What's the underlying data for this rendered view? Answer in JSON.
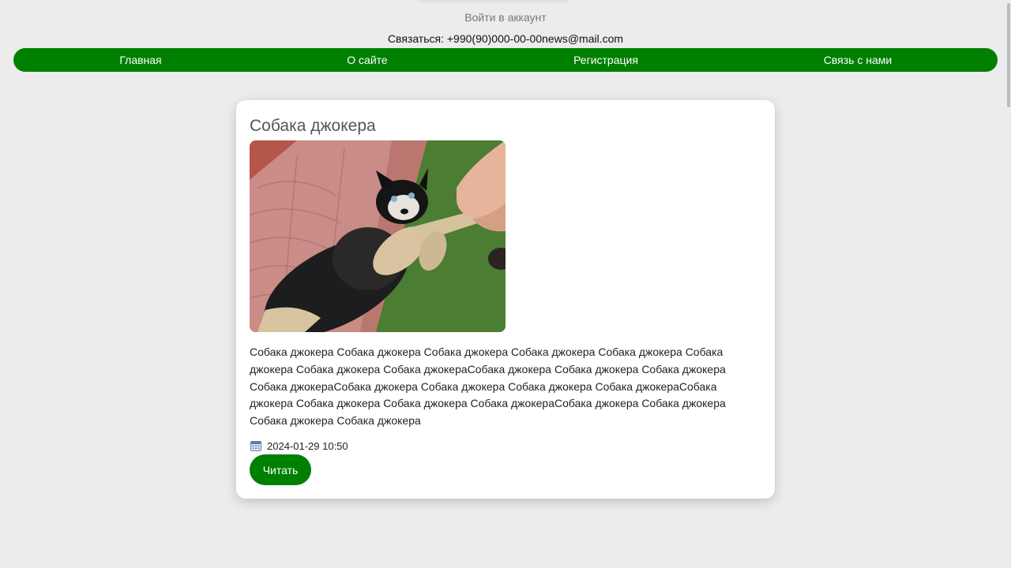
{
  "header": {
    "login_label": "Войти в аккаунт",
    "contact_text": "Связаться: +990(90)000-00-00news@mail.com"
  },
  "nav": {
    "items": [
      {
        "label": "Главная"
      },
      {
        "label": "О сайте"
      },
      {
        "label": "Регистрация"
      },
      {
        "label": "Связь с нами"
      }
    ],
    "color": "#008000"
  },
  "post": {
    "title": "Собака джокера",
    "image_icon": "dog-photo",
    "text": "Собака джокера Собака джокера Собака джокера Собака джокера Собака джокера Собака джокера Собака джокера Собака джокераСобака джокера Собака джокера Собака джокера Собака джокераСобака джокера Собака джокера Собака джокера Собака джокераСобака джокера Собака джокера Собака джокера Собака джокераСобака джокера Собака джокера Собака джокера Собака джокера",
    "date": "2024-01-29 10:50",
    "date_icon": "calendar-icon",
    "read_label": "Читать"
  },
  "colors": {
    "accent": "#008000",
    "background": "#ececec",
    "card": "#ffffff"
  }
}
